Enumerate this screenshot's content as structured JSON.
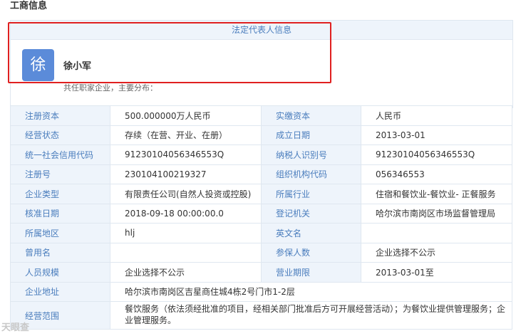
{
  "section_title": "工商信息",
  "legal_rep": {
    "header": "法定代表人信息",
    "avatar_char": "徐",
    "name": "徐小军",
    "hint": "共任职家企业，主要分布："
  },
  "rows": [
    {
      "k1": "注册资本",
      "v1": "500.000000万人民币",
      "k2": "实缴资本",
      "v2": "人民币"
    },
    {
      "k1": "经营状态",
      "v1": "存续（在营、开业、在册）",
      "k2": "成立日期",
      "v2": "2013-03-01"
    },
    {
      "k1": "统一社会信用代码",
      "v1": "91230104056346553Q",
      "k2": "纳税人识别号",
      "v2": "91230104056346553Q"
    },
    {
      "k1": "注册号",
      "v1": "230104100219327",
      "k2": "组织机构代码",
      "v2": "056346553"
    },
    {
      "k1": "企业类型",
      "v1": "有限责任公司(自然人投资或控股)",
      "k2": "所属行业",
      "v2": "住宿和餐饮业-餐饮业- 正餐服务"
    },
    {
      "k1": "核准日期",
      "v1": "2018-09-18 00:00:00.0",
      "k2": "登记机关",
      "v2": "哈尔滨市南岗区市场监督管理局"
    },
    {
      "k1": "所属地区",
      "v1": "hlj",
      "k2": "英文名",
      "v2": ""
    },
    {
      "k1": "曾用名",
      "v1": "",
      "k2": "参保人数",
      "v2": "企业选择不公示"
    },
    {
      "k1": "人员规模",
      "v1": "企业选择不公示",
      "k2": "营业期限",
      "v2": "2013-03-01至"
    }
  ],
  "address": {
    "k": "企业地址",
    "v": "哈尔滨市南岗区吉星商住城4栋2号门市1-2层"
  },
  "scope": {
    "k": "经营范围",
    "v": "餐饮服务（依法须经批准的项目，经相关部门批准后方可开展经营活动）；为餐饮业提供管理服务；企业管理服务。"
  },
  "watermark": "天眼查"
}
